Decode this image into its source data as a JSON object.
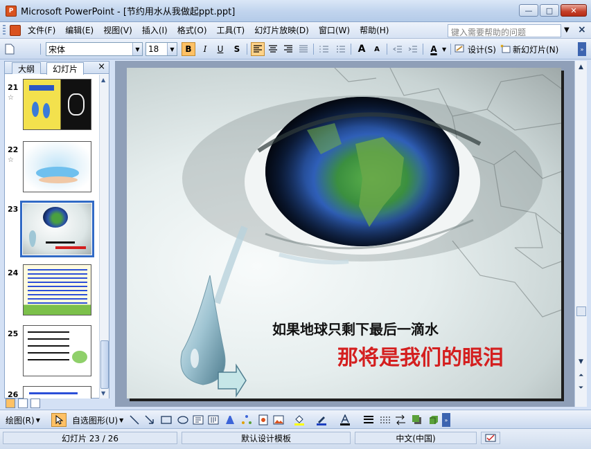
{
  "window": {
    "title": "Microsoft PowerPoint - [节约用水从我做起ppt.ppt]",
    "app_icon_label": "P",
    "minimize": "—",
    "maximize": "□",
    "close": "✕"
  },
  "menu": {
    "items": [
      "文件(F)",
      "编辑(E)",
      "视图(V)",
      "插入(I)",
      "格式(O)",
      "工具(T)",
      "幻灯片放映(D)",
      "窗口(W)",
      "帮助(H)"
    ],
    "help_placeholder": "键入需要帮助的问题",
    "help_arrow": "▼",
    "close": "×"
  },
  "toolbar": {
    "font_name": "宋体",
    "font_size": "18",
    "bold": "B",
    "italic": "I",
    "underline": "U",
    "shadow": "S",
    "grow_font": "A",
    "shrink_font": "A",
    "font_color": "A",
    "design_label": "设计(S)",
    "new_slide_label": "新幻灯片(N)"
  },
  "pane": {
    "tabs": [
      "大纲",
      "幻灯片"
    ],
    "close": "×",
    "slides": [
      {
        "number": "21",
        "star": "☆"
      },
      {
        "number": "22",
        "star": "☆"
      },
      {
        "number": "23",
        "star": ""
      },
      {
        "number": "24",
        "star": ""
      },
      {
        "number": "25",
        "star": ""
      },
      {
        "number": "26",
        "star": ""
      }
    ],
    "selected": "23"
  },
  "slide": {
    "line1": "如果地球只剩下最后一滴水",
    "line2": "那将是我们的眼泪"
  },
  "drawbar": {
    "draw_label": "绘图(R)",
    "autoshapes_label": "自选图形(U)"
  },
  "status": {
    "slide_position": "幻灯片 23 / 26",
    "template": "默认设计模板",
    "language": "中文(中国)"
  },
  "colors": {
    "accent": "#316ac5",
    "slide_title_red": "#d41f1f"
  }
}
